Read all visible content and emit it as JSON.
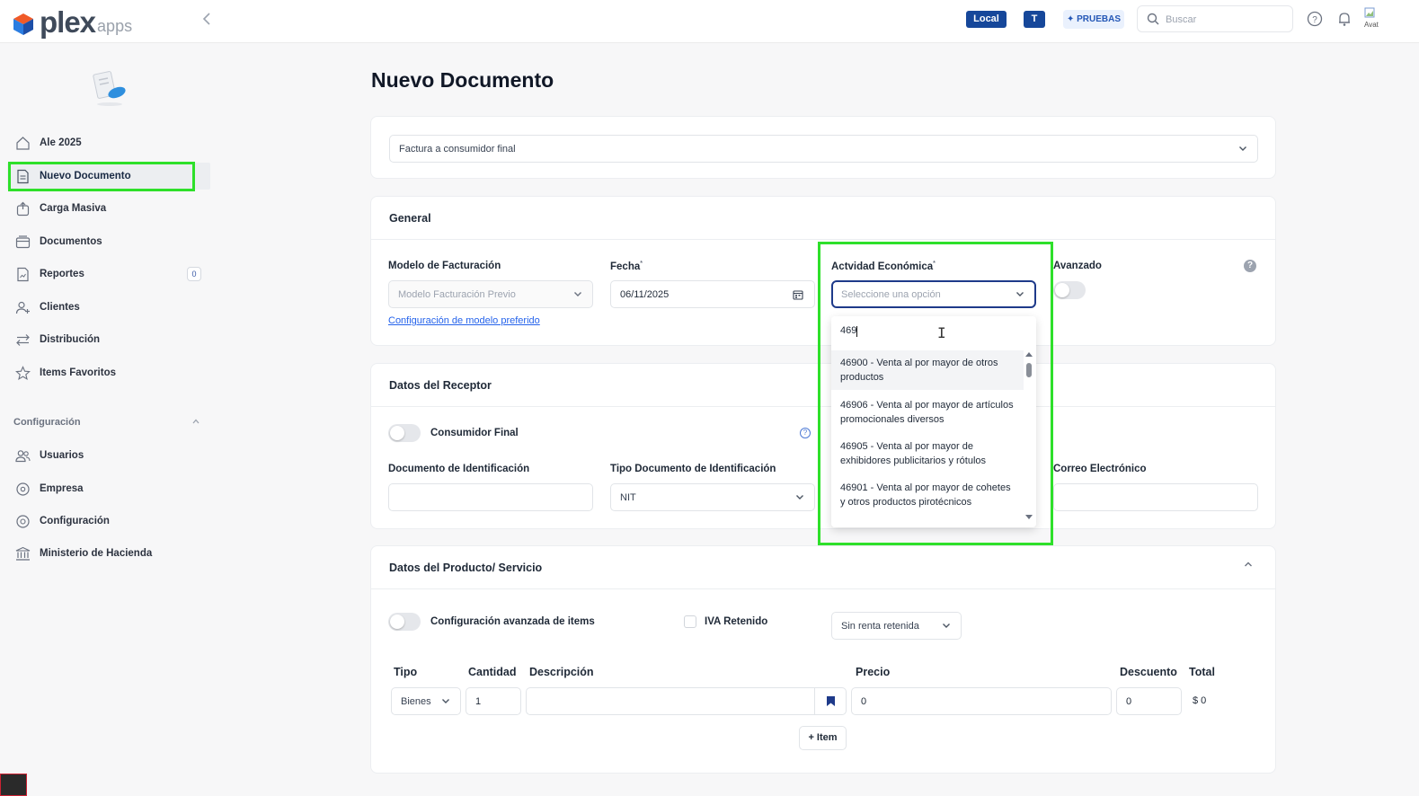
{
  "header": {
    "logo_text": "plex",
    "logo_sub": "apps",
    "env_badge": "Local",
    "user_badge": "T",
    "mode_badge": "PRUEBAS",
    "search_placeholder": "Buscar",
    "avatar_alt": "Avat"
  },
  "sidebar": {
    "items": [
      {
        "label": "Ale 2025",
        "icon": "home-icon"
      },
      {
        "label": "Nuevo Documento",
        "icon": "document-icon"
      },
      {
        "label": "Carga Masiva",
        "icon": "upload-icon"
      },
      {
        "label": "Documentos",
        "icon": "folder-icon"
      },
      {
        "label": "Reportes",
        "icon": "report-icon",
        "count": "0"
      },
      {
        "label": "Clientes",
        "icon": "user-add-icon"
      },
      {
        "label": "Distribución",
        "icon": "transfer-icon"
      },
      {
        "label": "Items Favoritos",
        "icon": "star-icon"
      }
    ],
    "config_section": "Configuración",
    "config_items": [
      {
        "label": "Usuarios",
        "icon": "users-icon"
      },
      {
        "label": "Empresa",
        "icon": "company-icon"
      },
      {
        "label": "Configuración",
        "icon": "settings-icon"
      },
      {
        "label": "Ministerio de Hacienda",
        "icon": "bank-icon"
      }
    ]
  },
  "main": {
    "title": "Nuevo Documento",
    "doc_type": "Factura a consumidor final",
    "general": {
      "title": "General",
      "modelo_label": "Modelo de Facturación",
      "modelo_value": "Modelo Facturación Previo",
      "modelo_link": "Configuración de modelo preferido",
      "fecha_label": "Fecha",
      "fecha_value": "06/11/2025",
      "actividad_label": "Actvidad Económica",
      "actividad_placeholder": "Seleccione una opción",
      "avanzado_label": "Avanzado",
      "required_mark": "*"
    },
    "dropdown": {
      "search_value": "469",
      "options": [
        "46900 - Venta al por mayor de otros productos",
        "46906 - Venta al por mayor de artículos promocionales diversos",
        "46905 - Venta al por mayor de exhibidores publicitarios y rótulos",
        "46901 - Venta al por mayor de cohetes y otros productos pirotécnicos"
      ]
    },
    "receptor": {
      "title": "Datos del Receptor",
      "consumidor_label": "Consumidor Final",
      "doc_id_label": "Documento de Identificación",
      "tipo_doc_label": "Tipo Documento de Identificación",
      "tipo_doc_value": "NIT",
      "correo_label": "Correo Electrónico"
    },
    "producto": {
      "title": "Datos del Producto/ Servicio",
      "config_avanzada_label": "Configuración avanzada de items",
      "iva_label": "IVA Retenido",
      "renta_value": "Sin renta retenida",
      "columns": {
        "tipo": "Tipo",
        "cantidad": "Cantidad",
        "descripcion": "Descripción",
        "precio": "Precio",
        "descuento": "Descuento",
        "total": "Total"
      },
      "row": {
        "tipo": "Bienes",
        "cantidad": "1",
        "descripcion": "",
        "precio": "0",
        "descuento": "0",
        "total": "$ 0"
      },
      "add_item_label": "+ Item"
    }
  },
  "colors": {
    "brand_blue": "#16479a",
    "highlight_green": "#2ee02a",
    "link_blue": "#2563eb"
  }
}
